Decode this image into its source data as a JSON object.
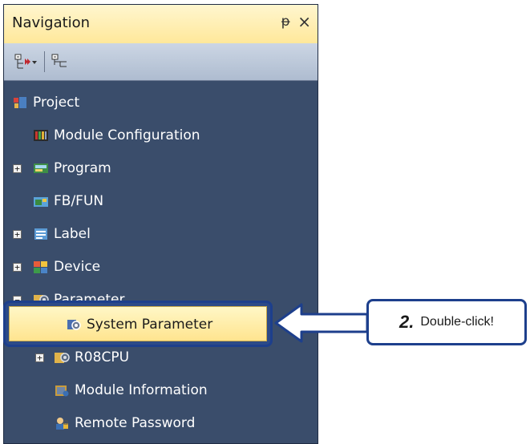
{
  "panel": {
    "title": "Navigation",
    "pin_glyph": "ᵽ",
    "close_glyph": "×"
  },
  "toolbar": {
    "buttons": [
      {
        "name": "expand-collapse-icon"
      },
      {
        "name": "collapse-all-icon"
      }
    ]
  },
  "tree": {
    "project": "Project",
    "module_configuration": "Module Configuration",
    "program": "Program",
    "fb_fun": "FB/FUN",
    "label": "Label",
    "device": "Device",
    "parameter": "Parameter",
    "system_parameter": "System Parameter",
    "r08cpu": "R08CPU",
    "module_information": "Module Information",
    "remote_password": "Remote Password"
  },
  "expanders": {
    "plus": "+",
    "minus": "−"
  },
  "callout": {
    "step": "2.",
    "text": "Double-click!"
  },
  "colors": {
    "panel_bg": "#3a4d6b",
    "titlebar": "#ffe89a",
    "highlight": "#1d3f8c",
    "selection": "#fff3b0"
  }
}
